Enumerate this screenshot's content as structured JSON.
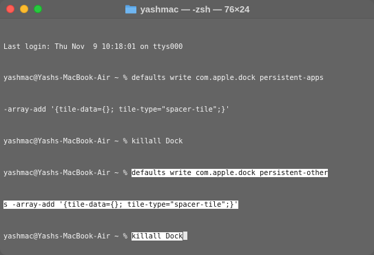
{
  "window": {
    "title": "yashmac — -zsh — 76×24"
  },
  "terminal": {
    "last_login": "Last login: Thu Nov  9 10:18:01 on ttys000",
    "prompt": "yashmac@Yashs-MacBook-Air ~ % ",
    "cmd1_line1": "defaults write com.apple.dock persistent-apps",
    "cmd1_line2": "-array-add '{tile-data={}; tile-type=\"spacer-tile\";}'",
    "cmd2": "killall Dock",
    "cmd3_line1": "defaults write com.apple.dock persistent-other",
    "cmd3_line2": "s -array-add '{tile-data={}; tile-type=\"spacer-tile\";}'",
    "cmd4": "killall Dock"
  }
}
